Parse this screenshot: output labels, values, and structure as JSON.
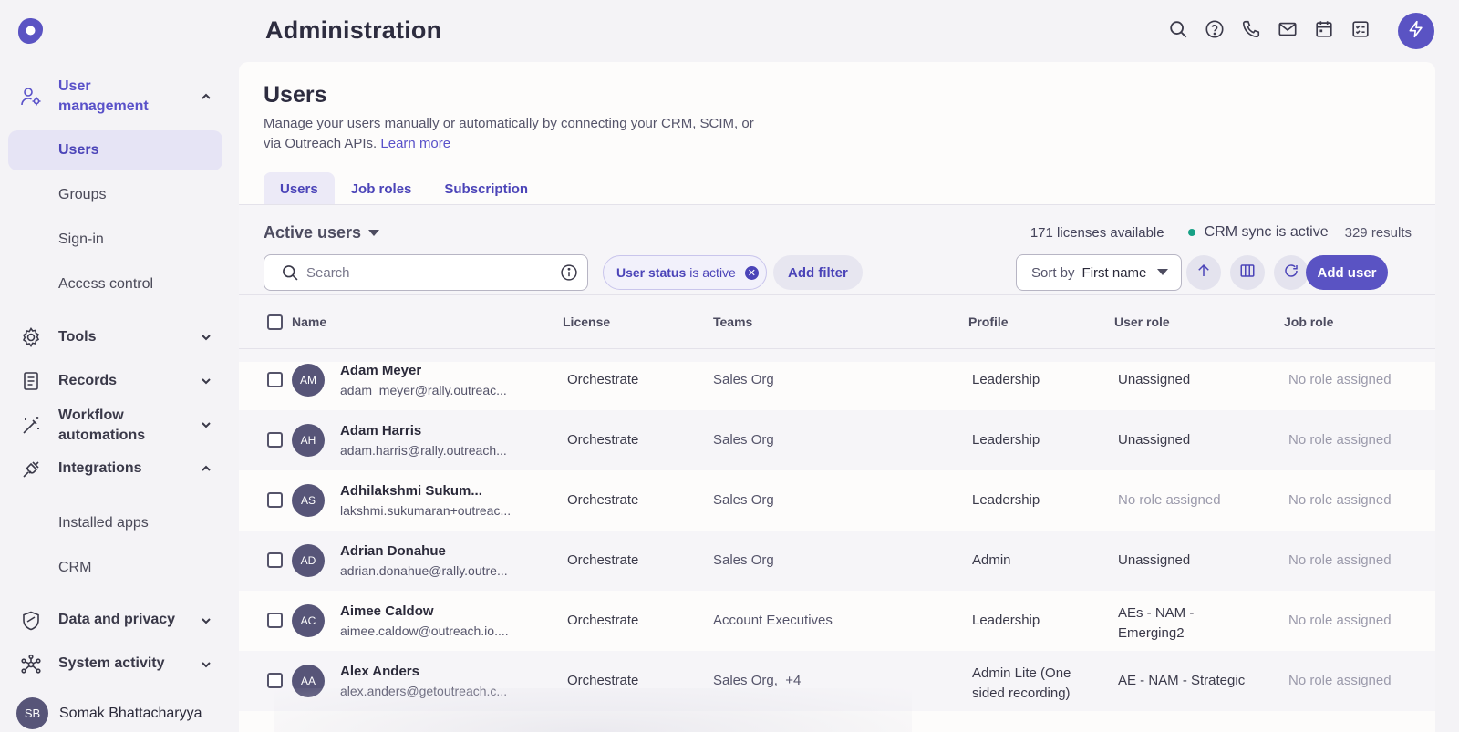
{
  "header": {
    "title": "Administration"
  },
  "sidebar": {
    "groups": {
      "user_management": "User management",
      "tools": "Tools",
      "records": "Records",
      "workflow": "Workflow automations",
      "integrations": "Integrations",
      "data_privacy": "Data and privacy",
      "system_activity": "System activity"
    },
    "user_items": [
      "Users",
      "Groups",
      "Sign-in",
      "Access control"
    ],
    "integration_items": [
      "Installed apps",
      "CRM"
    ],
    "profile": {
      "initials": "SB",
      "name": "Somak Bhattacharyya"
    }
  },
  "page": {
    "title": "Users",
    "description": "Manage your users manually or automatically by connecting your CRM, SCIM, or via Outreach APIs.",
    "learn_more": "Learn more",
    "tabs": [
      "Users",
      "Job roles",
      "Subscription"
    ]
  },
  "filters": {
    "view": "Active users",
    "licenses": "171 licenses available",
    "crm_sync": "CRM sync is active",
    "results": "329 results",
    "search_placeholder": "Search",
    "chip_field": "User status",
    "chip_value": "is active",
    "add_filter": "Add filter",
    "sort_label": "Sort by",
    "sort_value": "First name",
    "add_user": "Add user"
  },
  "table": {
    "columns": [
      "Name",
      "License",
      "Teams",
      "Profile",
      "User role",
      "Job role"
    ],
    "rows": [
      {
        "initials": "AM",
        "name": "Adam Meyer",
        "email": "adam_meyer@rally.outreac...",
        "license": "Orchestrate",
        "teams": "Sales Org",
        "profile": "Leadership",
        "user_role": "Unassigned",
        "job_role": "No role assigned"
      },
      {
        "initials": "AH",
        "name": "Adam Harris",
        "email": "adam.harris@rally.outreach...",
        "license": "Orchestrate",
        "teams": "Sales Org",
        "profile": "Leadership",
        "user_role": "Unassigned",
        "job_role": "No role assigned"
      },
      {
        "initials": "AS",
        "name": "Adhilakshmi Sukum...",
        "email": "lakshmi.sukumaran+outreac...",
        "license": "Orchestrate",
        "teams": "Sales Org",
        "profile": "Leadership",
        "user_role": "No role assigned",
        "job_role": "No role assigned"
      },
      {
        "initials": "AD",
        "name": "Adrian Donahue",
        "email": "adrian.donahue@rally.outre...",
        "license": "Orchestrate",
        "teams": "Sales Org",
        "profile": "Admin",
        "user_role": "Unassigned",
        "job_role": "No role assigned"
      },
      {
        "initials": "AC",
        "name": "Aimee Caldow",
        "email": "aimee.caldow@outreach.io....",
        "license": "Orchestrate",
        "teams": "Account Executives",
        "profile": "Leadership",
        "user_role": "AEs - NAM - Emerging2",
        "job_role": "No role assigned"
      },
      {
        "initials": "AA",
        "name": "Alex Anders",
        "email": "alex.anders@getoutreach.c...",
        "license": "Orchestrate",
        "teams": "Sales Org,  +4",
        "profile": "Admin Lite (One sided recording)",
        "user_role": "AE - NAM - Strategic",
        "job_role": "No role assigned"
      }
    ]
  }
}
